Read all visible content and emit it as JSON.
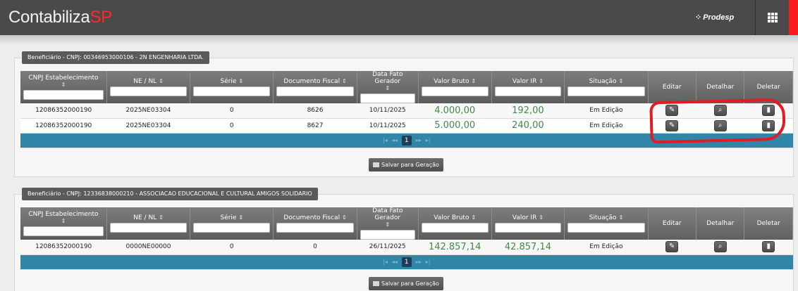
{
  "app": {
    "logo_main": "Contabiliza",
    "logo_accent": "SP",
    "partner": "Prodesp",
    "partner_symbol": "⁘"
  },
  "columns": {
    "cnpj": "CNPJ Estabelecimento",
    "ne_nl": "NE / NL",
    "serie": "Série",
    "documento": "Documento Fiscal",
    "data": "Data Fato Gerador",
    "valor_bruto": "Valor Bruto",
    "valor_ir": "Valor IR",
    "situacao": "Situação",
    "editar": "Editar",
    "detalhar": "Detalhar",
    "deletar": "Deletar"
  },
  "sort_glyph": "⇕",
  "pager": {
    "first": "|◂",
    "prev": "◂◂",
    "current": "1",
    "next": "▸▸",
    "last": "▸|"
  },
  "save_label": "Salvar para Geração",
  "groups": [
    {
      "title": "Beneficiário - CNPJ: 00346953000106 - 2N ENGENHARIA LTDA.",
      "rows": [
        {
          "cnpj": "12086352000190",
          "ne": "2025NE03304",
          "serie": "0",
          "doc": "8626",
          "data": "10/11/2025",
          "bruto": "4.000,00",
          "ir": "192,00",
          "situacao": "Em Edição"
        },
        {
          "cnpj": "12086352000190",
          "ne": "2025NE03304",
          "serie": "0",
          "doc": "8627",
          "data": "10/11/2025",
          "bruto": "5.000,00",
          "ir": "240,00",
          "situacao": "Em Edição"
        }
      ]
    },
    {
      "title": "Beneficiário - CNPJ: 12336838000210 - ASSOCIACAO EDUCACIONAL E CULTURAL AMIGOS SOLIDARIO",
      "rows": [
        {
          "cnpj": "12086352000190",
          "ne": "0000NE00000",
          "serie": "0",
          "doc": "0",
          "data": "26/11/2025",
          "bruto": "142.857,14",
          "ir": "42.857,14",
          "situacao": "Em Edição"
        }
      ]
    }
  ],
  "icons": {
    "edit": "pencil-icon",
    "detail": "magnifier-icon",
    "delete": "trash-icon"
  },
  "colors": {
    "header": "#4a4a4a",
    "accent_red": "#ff1b1b",
    "money_green": "#3f8a48",
    "pager_blue": "#2f86a8",
    "annotation_red": "#e31b22"
  }
}
